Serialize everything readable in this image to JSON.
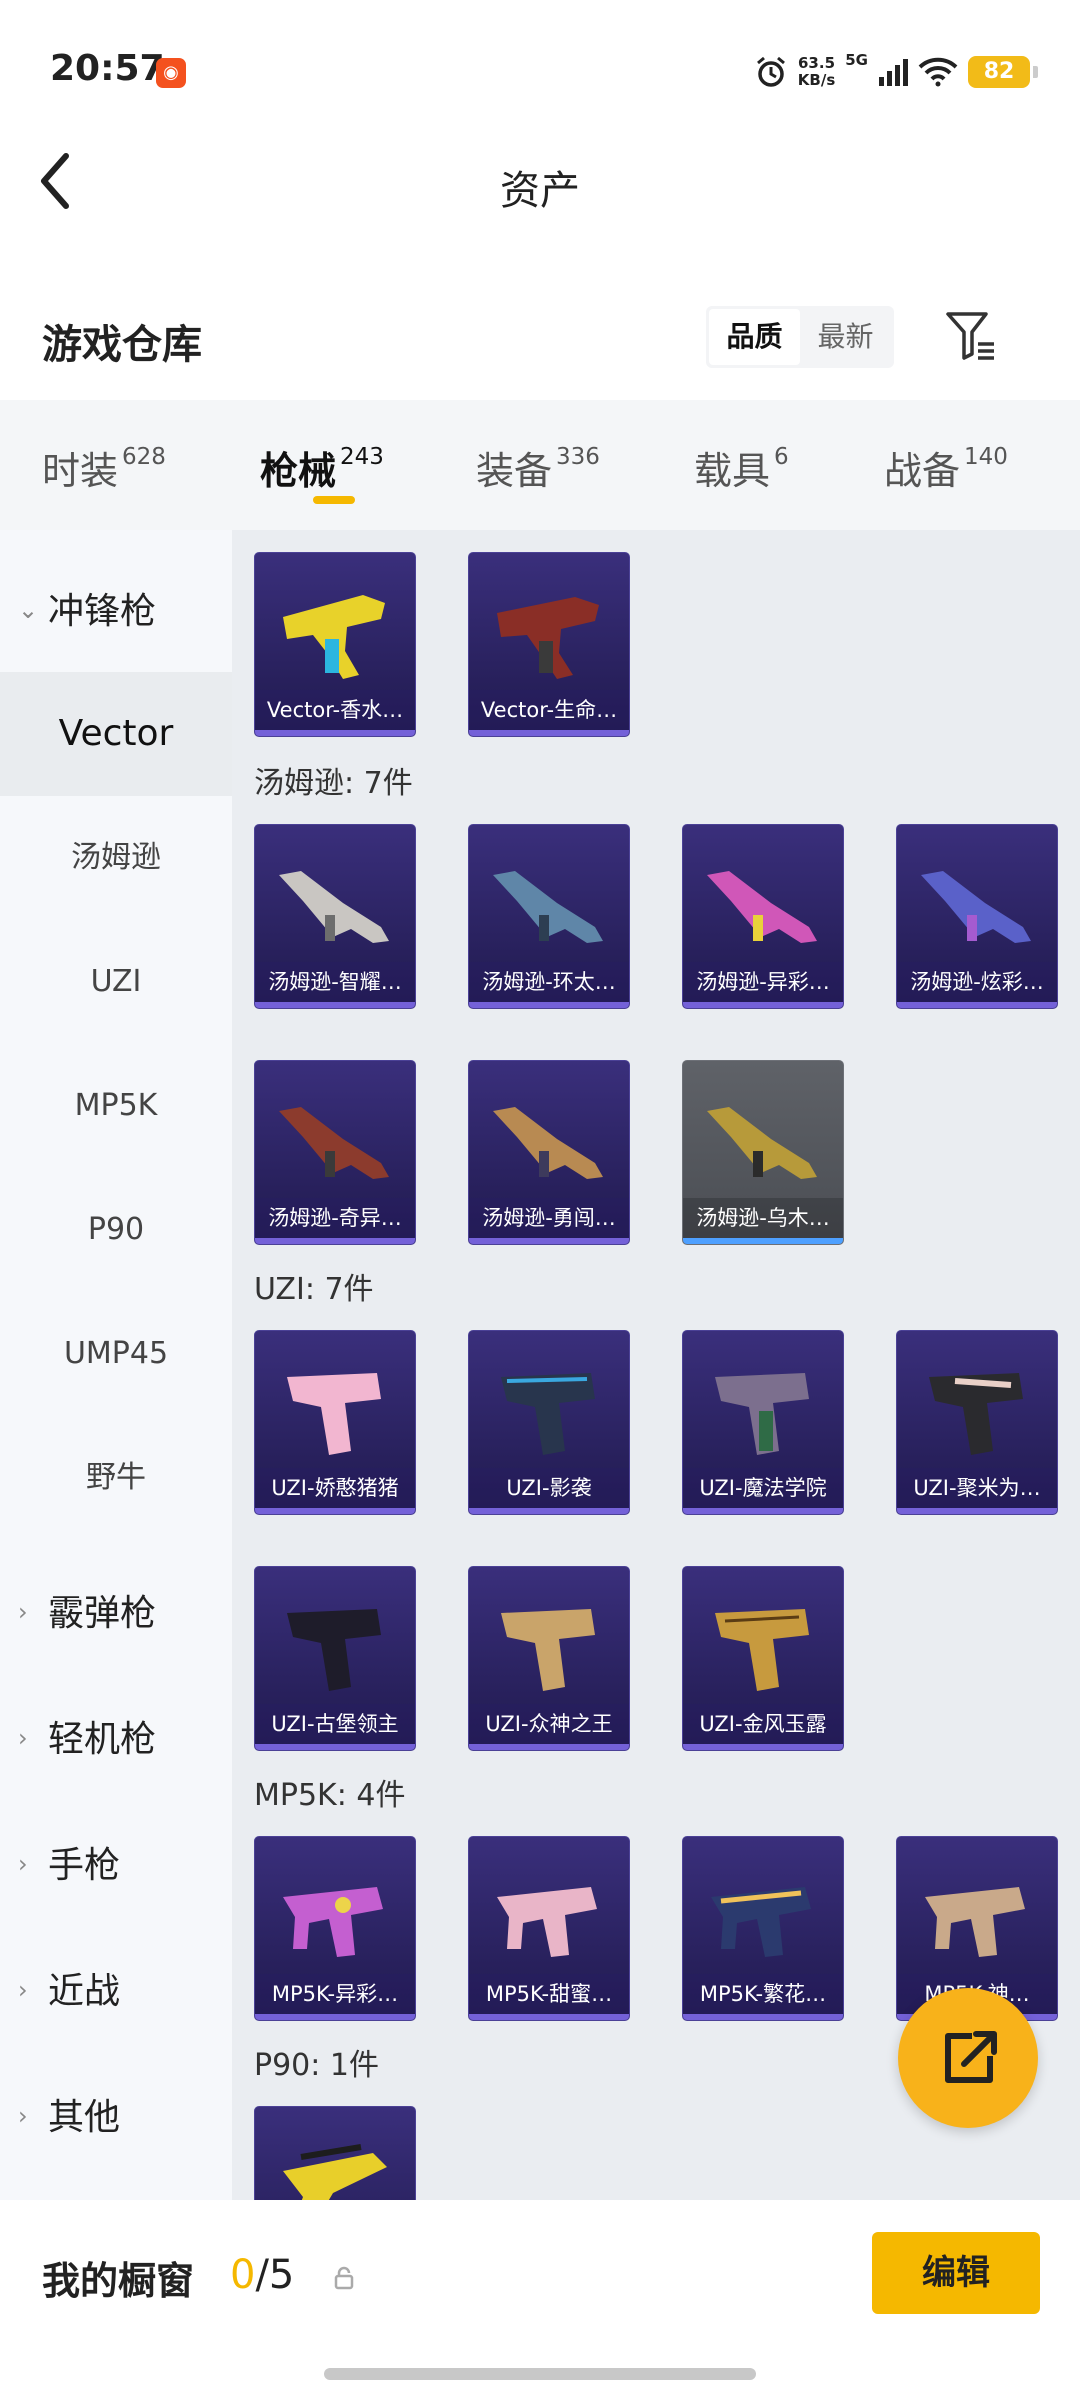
{
  "status_bar": {
    "time": "20:57",
    "net_speed_value": "63.5",
    "net_speed_unit": "KB/s",
    "network": "5G",
    "battery": "82"
  },
  "header": {
    "title": "资产"
  },
  "warehouse": {
    "title": "游戏仓库",
    "sort_quality": "品质",
    "sort_newest": "最新"
  },
  "tabs": [
    {
      "label": "时装",
      "count": "628"
    },
    {
      "label": "枪械",
      "count": "243"
    },
    {
      "label": "装备",
      "count": "336"
    },
    {
      "label": "载具",
      "count": "6"
    },
    {
      "label": "战备",
      "count": "140"
    }
  ],
  "sidebar": {
    "group_smg": "冲锋枪",
    "items": [
      "Vector",
      "汤姆逊",
      "UZI",
      "MP5K",
      "P90",
      "UMP45",
      "野牛"
    ],
    "groups": [
      "霰弹枪",
      "轻机枪",
      "手枪",
      "近战",
      "其他"
    ]
  },
  "sections": {
    "thompson": "汤姆逊: 7件",
    "uzi": "UZI: 7件",
    "mp5k": "MP5K: 4件",
    "p90": "P90: 1件"
  },
  "cards": {
    "vector": [
      "Vector-香水…",
      "Vector-生命…"
    ],
    "thompson": [
      "汤姆逊-智耀…",
      "汤姆逊-环太…",
      "汤姆逊-异彩…",
      "汤姆逊-炫彩…",
      "汤姆逊-奇异…",
      "汤姆逊-勇闯…",
      "汤姆逊-乌木…"
    ],
    "uzi": [
      "UZI-娇憨猪猪",
      "UZI-影袭",
      "UZI-魔法学院",
      "UZI-聚米为…",
      "UZI-古堡领主",
      "UZI-众神之王",
      "UZI-金风玉露"
    ],
    "mp5k": [
      "MP5K-异彩…",
      "MP5K-甜蜜…",
      "MP5K-繁花…",
      "MP5K-神…"
    ]
  },
  "bottom": {
    "label": "我的橱窗",
    "current": "0",
    "total": "/5",
    "edit": "编辑"
  },
  "colors": {
    "accent": "#f5b800",
    "card_bg": "#2b2363",
    "content_bg": "#eaedf1"
  },
  "icons": [
    "back-arrow-icon",
    "filter-icon",
    "alarm-icon",
    "signal-icon",
    "wifi-icon",
    "battery-icon",
    "share-external-icon",
    "lock-icon",
    "chevron-down-icon",
    "chevron-right-icon"
  ]
}
